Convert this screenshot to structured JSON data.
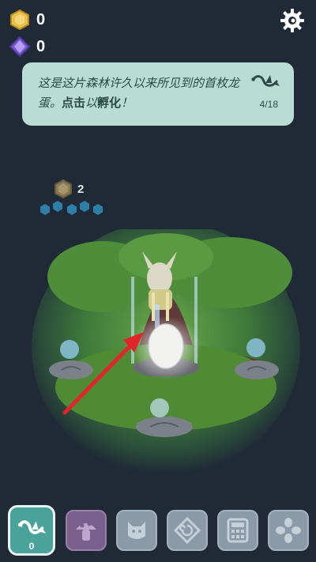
{
  "currency": {
    "coins": "0",
    "gems": "0"
  },
  "tip": {
    "message_plain": "这是这片森林许久以来所见到的首枚龙蛋。",
    "message_action": "点击",
    "message_mid": "以",
    "message_action2": "孵化",
    "message_end": "！",
    "progress": "4/18"
  },
  "scene": {
    "level_value": "2",
    "progress_hexes_filled": 5
  },
  "toolbar": {
    "buttons": [
      {
        "icon": "dragon-icon",
        "badge": "0",
        "active": true
      },
      {
        "icon": "mushroom-icon",
        "locked": true
      },
      {
        "icon": "cat-icon"
      },
      {
        "icon": "spiral-tile-icon"
      },
      {
        "icon": "calculator-icon"
      },
      {
        "icon": "flower-icon"
      }
    ]
  },
  "colors": {
    "background": "#1f2a36",
    "tip_bg": "#b9dcd3",
    "active_button": "#4aa39a",
    "hex_blue": "#2e7fa8",
    "arrow_red": "#e3242b"
  }
}
